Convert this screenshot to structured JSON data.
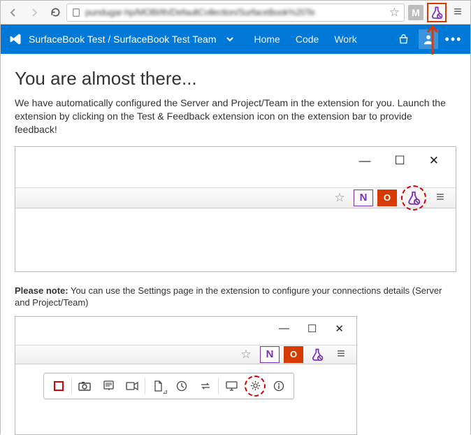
{
  "browser": {
    "url_blur": "pundugar-hp/MOBI/th/DefaultCollection/SurfaceBook%20Te",
    "m_badge": "M"
  },
  "header": {
    "breadcrumb": "SurfaceBook Test / SurfaceBook Test Team",
    "links": {
      "home": "Home",
      "code": "Code",
      "work": "Work"
    },
    "ellipsis": "•••"
  },
  "main": {
    "title": "You are almost there...",
    "intro": "We have automatically configured the Server and Project/Team in the extension for you. Launch the extension by clicking on the Test & Feedback extension icon on the extension bar to provide feedback!",
    "note_label": "Please note:",
    "note_text": " You can use the Settings page in the extension to configure your connections details (Server and Project/Team)"
  },
  "window_controls": {
    "min": "—",
    "max": "☐",
    "close": "✕"
  },
  "icons": {
    "star": "☆",
    "onenote": "N",
    "office": "O",
    "hamburger": "≡"
  }
}
